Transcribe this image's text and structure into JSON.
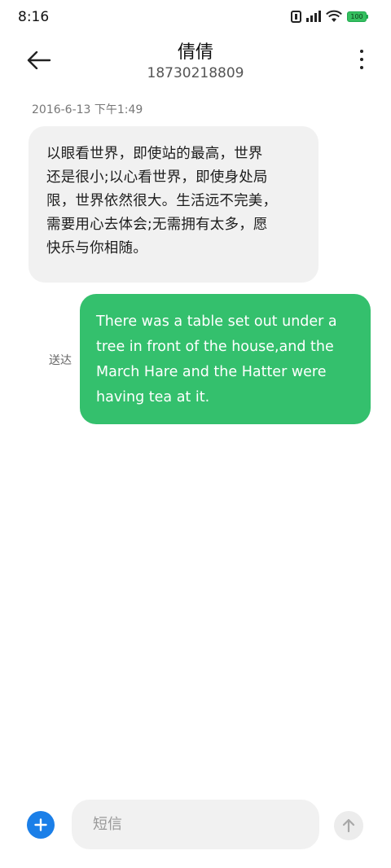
{
  "status_bar": {
    "time": "8:16",
    "battery": "100",
    "battery_color": "#36c060"
  },
  "header": {
    "contact_name": "倩倩",
    "phone_number": "18730218809",
    "back_icon": "arrow-left-icon",
    "more_icon": "more-vertical-icon"
  },
  "messages": [
    {
      "direction": "incoming",
      "timestamp": "2016-6-13 下午1:49",
      "lines": [
        "以眼看世界，即使站的最高，世界",
        "还是很小;以心看世界，即使身处局",
        "限，世界依然很大。生活远不完美，",
        "需要用心去体会;无需拥有太多，愿",
        "快乐与你相随。"
      ]
    },
    {
      "direction": "outgoing",
      "status": "送达",
      "lines": [
        "There was a table set out under a",
        "tree in front of the house,and the",
        "March Hare and the Hatter were",
        "having tea at it."
      ],
      "bubble_color": "#34c06d"
    }
  ],
  "composer": {
    "placeholder": "短信",
    "value": "",
    "add_icon": "plus-icon",
    "send_icon": "arrow-up-icon",
    "accent_color": "#1b7fe8"
  }
}
